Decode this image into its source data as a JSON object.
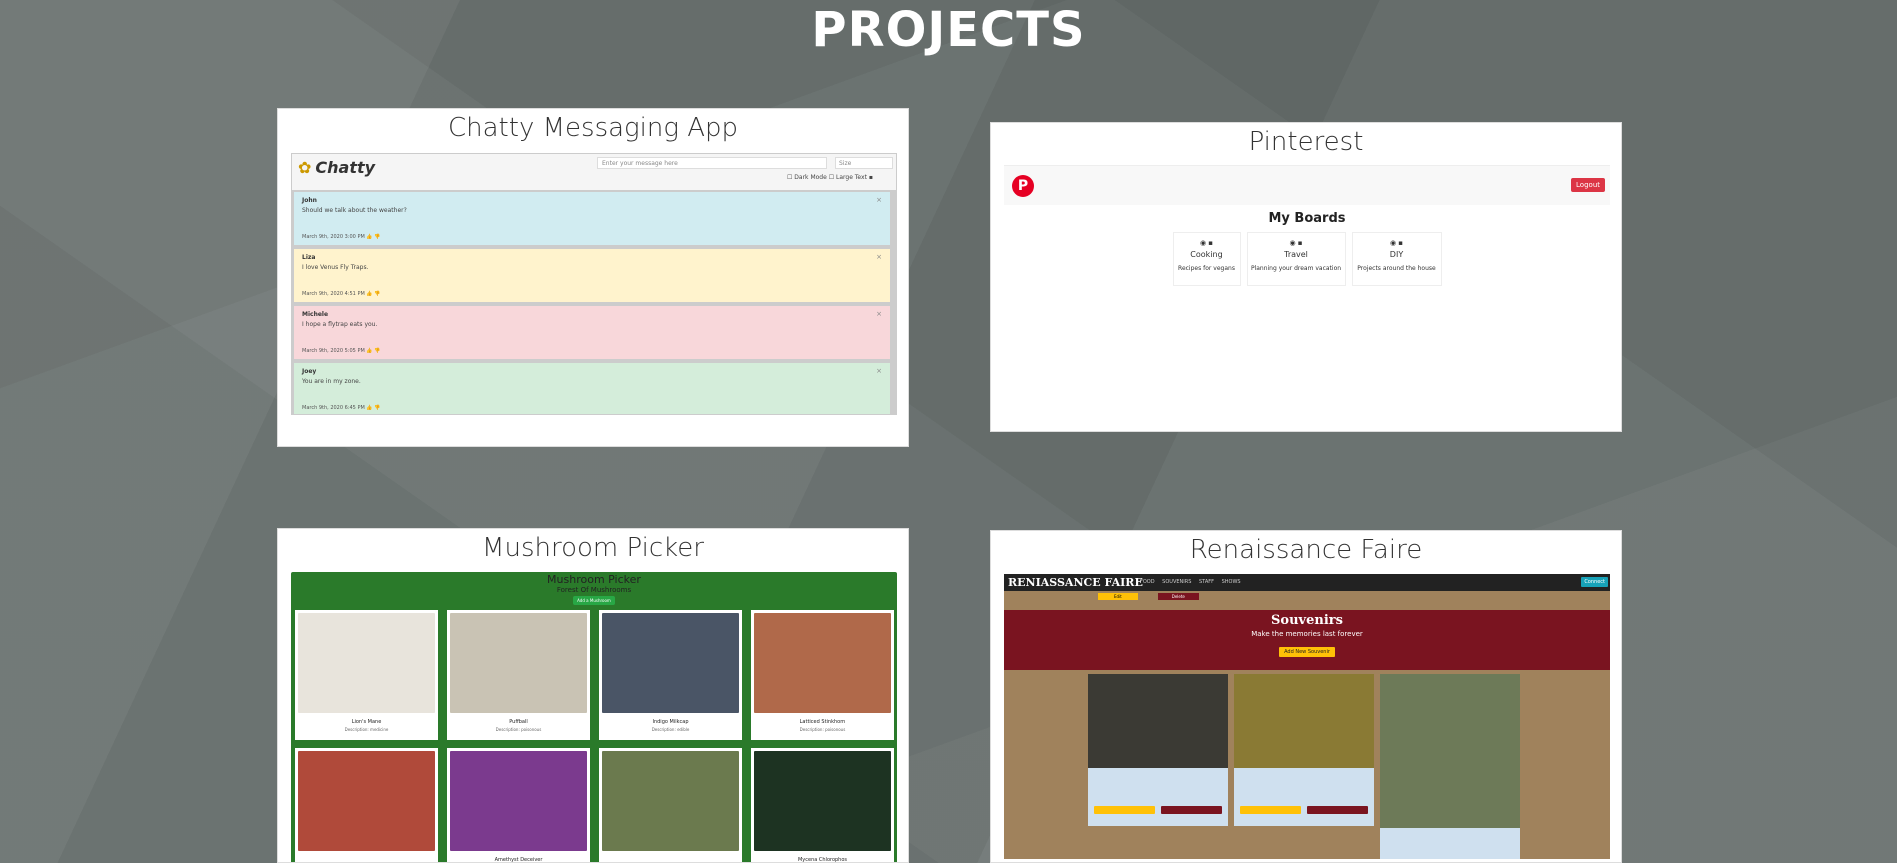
{
  "page_title": "PROJECTS",
  "projects": [
    {
      "title": "Chatty Messaging App",
      "app": {
        "logo": "Chatty",
        "input_placeholder": "Enter your message here",
        "size_label": "Size",
        "dark_mode": "Dark Mode",
        "large_text": "Large Text",
        "messages": [
          {
            "name": "John",
            "text": "Should we talk about the weather?",
            "time": "March 9th, 2020 3:00 PM",
            "color": "#d1ecf1"
          },
          {
            "name": "Liza",
            "text": "I love Venus Fly Traps.",
            "time": "March 9th, 2020 4:51 PM",
            "color": "#fff3cd"
          },
          {
            "name": "Michele",
            "text": "I hope a flytrap eats you.",
            "time": "March 9th, 2020 5:05 PM",
            "color": "#f8d7da"
          },
          {
            "name": "Joey",
            "text": "You are in my zone.",
            "time": "March 9th, 2020 6:45 PM",
            "color": "#d4edda"
          }
        ]
      }
    },
    {
      "title": "Pinterest",
      "app": {
        "logo": "P",
        "logout": "Logout",
        "heading": "My Boards",
        "boards": [
          {
            "name": "Cooking",
            "desc": "Recipes for vegans"
          },
          {
            "name": "Travel",
            "desc": "Planning your dream vacation"
          },
          {
            "name": "DIY",
            "desc": "Projects around the house"
          }
        ]
      }
    },
    {
      "title": "Mushroom Picker",
      "app": {
        "heading": "Mushroom Picker",
        "subheading": "Forest Of Mushrooms",
        "button": "Add a Mushroom",
        "mushrooms": [
          {
            "name": "Lion's Mane",
            "desc": "Description: medicine",
            "color": "#e8e4dc"
          },
          {
            "name": "Puffball",
            "desc": "Description: poisonous",
            "color": "#c9c3b4"
          },
          {
            "name": "Indigo Milkcap",
            "desc": "Description: edible",
            "color": "#4a5566"
          },
          {
            "name": "Latticed Stinkhorn",
            "desc": "Description: poisonous",
            "color": "#b0694a"
          },
          {
            "name": "",
            "desc": "",
            "color": "#b04a3a"
          },
          {
            "name": "Amethyst Deceiver",
            "desc": "Description: edible",
            "color": "#7b3a8e"
          },
          {
            "name": "",
            "desc": "",
            "color": "#6b7a4e"
          },
          {
            "name": "Mycena Chlorophos",
            "desc": "",
            "color": "#1d3322"
          }
        ]
      }
    },
    {
      "title": "Renaissance Faire",
      "app": {
        "logo": "RENIASSANCE FAIRE",
        "nav": "FOOD SOUVENIRS STAFF SHOWS",
        "cta": "Connect",
        "edit": "Edit",
        "delete": "Delete",
        "banner_title": "Souvenirs",
        "banner_sub": "Make the memories last forever",
        "banner_button": "Add New Souvenir"
      }
    }
  ]
}
